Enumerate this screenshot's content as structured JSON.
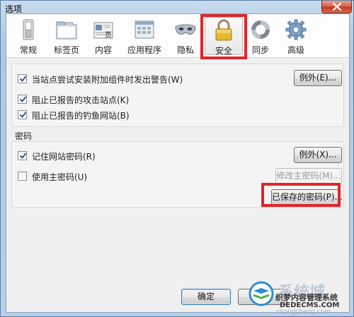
{
  "window": {
    "title": "选项"
  },
  "tabs": [
    {
      "label": "常规",
      "icon": "switch-icon"
    },
    {
      "label": "标签页",
      "icon": "tabs-icon"
    },
    {
      "label": "内容",
      "icon": "content-page-icon"
    },
    {
      "label": "应用程序",
      "icon": "application-icon"
    },
    {
      "label": "隐私",
      "icon": "mask-icon"
    },
    {
      "label": "安全",
      "icon": "padlock-icon",
      "selected": true
    },
    {
      "label": "同步",
      "icon": "sync-icon"
    },
    {
      "label": "高级",
      "icon": "gear-icon"
    }
  ],
  "security": {
    "warn_addons": {
      "label": "当站点尝试安装附加组件时发出警告(W)",
      "checked": true
    },
    "exceptions1": "例外(E)...",
    "block_attack": {
      "label": "阻止已报告的攻击站点(K)",
      "checked": true
    },
    "block_forgery": {
      "label": "阻止已报告的钓鱼网站(B)",
      "checked": true
    }
  },
  "passwords": {
    "group_label": "密码",
    "remember": {
      "label": "记住网站密码(R)",
      "checked": true
    },
    "exceptions2": "例外(X)...",
    "master": {
      "label": "使用主密码(U)",
      "checked": false
    },
    "change_master": "修改主密码(M)...",
    "saved_passwords": "已保存的密码(P)..."
  },
  "footer": {
    "ok": "确定",
    "cancel_partial": "消"
  },
  "watermark": {
    "line1": "织梦内容管理系统",
    "line2": "DEDECMS.COM",
    "brand": "系统城",
    "site": "xitongcheng.com"
  },
  "colors": {
    "highlight": "#e0252b",
    "title_bar": "#bcd3ea",
    "client_bg": "#f0f0f0",
    "default_button_border": "#3c7fb1"
  }
}
